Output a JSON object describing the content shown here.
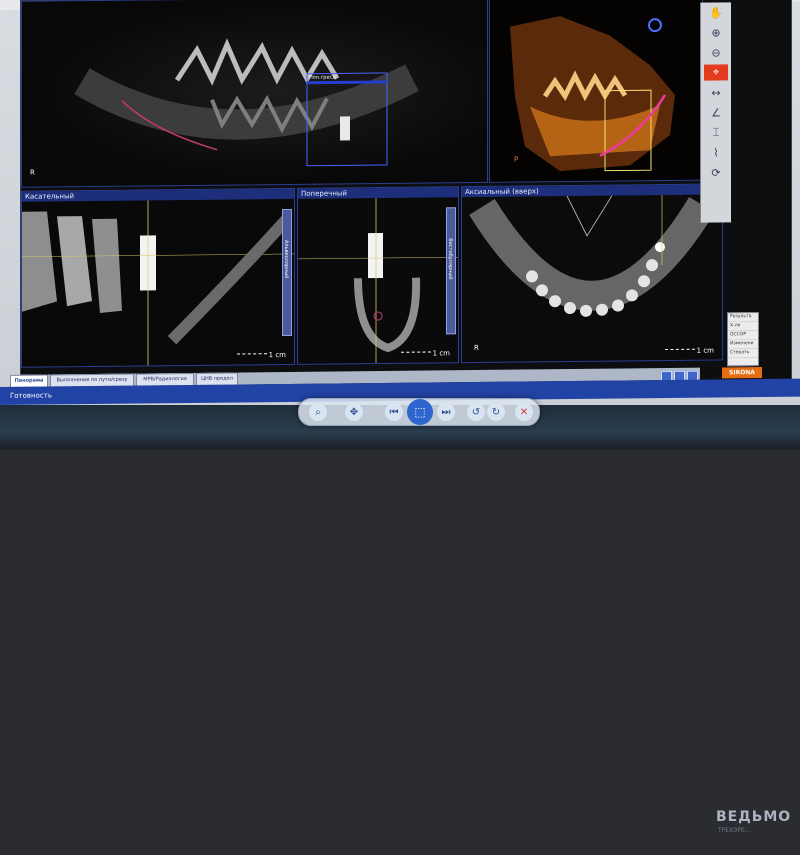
{
  "panels": {
    "panorama_top": {
      "label": "",
      "corner": "R",
      "cross_label": "Поп.гресд"
    },
    "volume_3d": {
      "label": "",
      "corner": "P",
      "scale": ""
    },
    "tangential": {
      "label": "Касательный",
      "scale": "1 cm",
      "ruler": "Альвеолярный"
    },
    "cross": {
      "label": "Поперечный",
      "scale": "1 cm",
      "ruler": "Вестибулярный"
    },
    "axial": {
      "label": "Аксиальный (вверх)",
      "corner": "R",
      "scale": "1 cm"
    }
  },
  "tabs": [
    {
      "label": "Панорама"
    },
    {
      "label": "Выполнение по пути/срезу"
    },
    {
      "label": "МРВ/Радиология"
    },
    {
      "label": "ЦНВ продол"
    }
  ],
  "status": "Готовность",
  "logo": "SIRONA",
  "toolbar": [
    {
      "icon": "hand-icon"
    },
    {
      "icon": "zoom-in-icon"
    },
    {
      "icon": "zoom-out-icon"
    },
    {
      "icon": "rotate-icon"
    },
    {
      "icon": "tool-red"
    },
    {
      "icon": "measure-icon"
    },
    {
      "icon": "angle-icon"
    },
    {
      "icon": "implant-icon"
    },
    {
      "icon": "nerve-icon"
    }
  ],
  "menu": [
    "Результа",
    "Х-ле",
    "ОССОР",
    "Изменени",
    "Стерать"
  ],
  "background": {
    "title": "ВЕДЬМО",
    "subtitle": "ТРЕХЭРЕ..."
  },
  "player": {
    "zoom": "zoom",
    "move": "move",
    "prev": "prev",
    "main": "main",
    "next": "next",
    "rot1": "rotate-left",
    "rot2": "rotate-right",
    "close": "close"
  }
}
